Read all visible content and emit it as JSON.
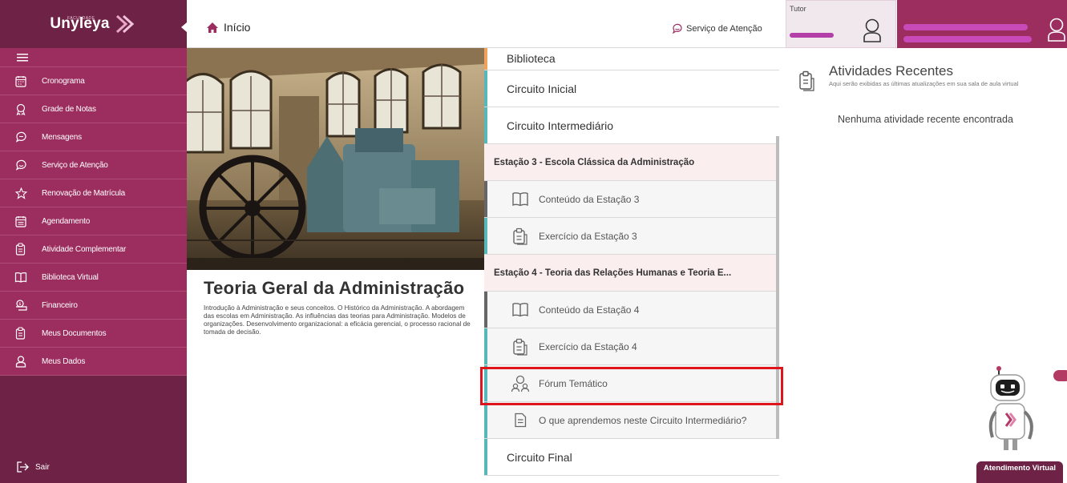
{
  "sidebar": {
    "brand_small": "FACULDADE",
    "brand_name": "Unyleya",
    "menu": [
      {
        "label": "Cronograma",
        "icon": "calendar-icon"
      },
      {
        "label": "Grade de Notas",
        "icon": "award-icon"
      },
      {
        "label": "Mensagens",
        "icon": "chat-icon"
      },
      {
        "label": "Serviço de Atenção",
        "icon": "support-chat-icon"
      },
      {
        "label": "Renovação de Matrícula",
        "icon": "star-icon"
      },
      {
        "label": "Agendamento",
        "icon": "schedule-icon"
      },
      {
        "label": "Atividade Complementar",
        "icon": "clipboard-icon"
      },
      {
        "label": "Biblioteca Virtual",
        "icon": "book-icon"
      },
      {
        "label": "Financeiro",
        "icon": "finance-icon"
      },
      {
        "label": "Meus Documentos",
        "icon": "document-icon"
      },
      {
        "label": "Meus Dados",
        "icon": "user-icon"
      }
    ],
    "logout_label": "Sair"
  },
  "topbar": {
    "home_label": "Início",
    "service_label": "Serviço de Atenção",
    "tutor_label": "Tutor"
  },
  "course": {
    "title": "Teoria Geral da Administração",
    "description": "Introdução à Administração e seus conceitos. O Histórico da Administração. A abordagem das escolas em Administração. As influências das teorias para Administração. Modelos de organizações. Desenvolvimento organizacional: a eficácia gerencial, o processo racional de tomada de decisão."
  },
  "modules": {
    "rows": [
      {
        "type": "circuit",
        "label": "Biblioteca",
        "accent": "#f0a25a"
      },
      {
        "type": "circuit",
        "label": "Circuito Inicial",
        "accent": "#56b8b8"
      },
      {
        "type": "circuit",
        "label": "Circuito Intermediário",
        "accent": "#56b8b8"
      },
      {
        "type": "station",
        "label": "Estação 3 - Escola Clássica da Administração"
      },
      {
        "type": "sub",
        "label": "Conteúdo da Estação 3",
        "icon": "book-icon",
        "accent": "#666666"
      },
      {
        "type": "sub",
        "label": "Exercício da Estação 3",
        "icon": "clipboard-icon",
        "accent": "#56b8b8"
      },
      {
        "type": "station",
        "label": "Estação 4 - Teoria das Relações Humanas e Teoria E..."
      },
      {
        "type": "sub",
        "label": "Conteúdo da Estação 4",
        "icon": "book-icon",
        "accent": "#666666"
      },
      {
        "type": "sub",
        "label": "Exercício da Estação 4",
        "icon": "clipboard-icon",
        "accent": "#56b8b8"
      },
      {
        "type": "sub",
        "label": "Fórum Temático",
        "icon": "forum-icon",
        "accent": "#56b8b8"
      },
      {
        "type": "sub",
        "label": "O que aprendemos neste Circuito Intermediário?",
        "icon": "note-icon",
        "accent": "#56b8b8"
      },
      {
        "type": "circuit",
        "label": "Circuito Final",
        "accent": "#56b8b8"
      }
    ]
  },
  "activity": {
    "title": "Atividades Recentes",
    "subtitle": "Aqui serão exibidas as últimas atualizações em sua sala de aula virtual",
    "empty": "Nenhuma atividade recente encontrada"
  },
  "assistant": {
    "chat_label": "Atendimento Virtual"
  },
  "colors": {
    "sidebar_dark": "#6e2346",
    "sidebar_menu": "#9c2d5f",
    "accent_teal": "#56b8b8",
    "accent_orange": "#f0a25a",
    "highlight_red": "#e0151b"
  }
}
